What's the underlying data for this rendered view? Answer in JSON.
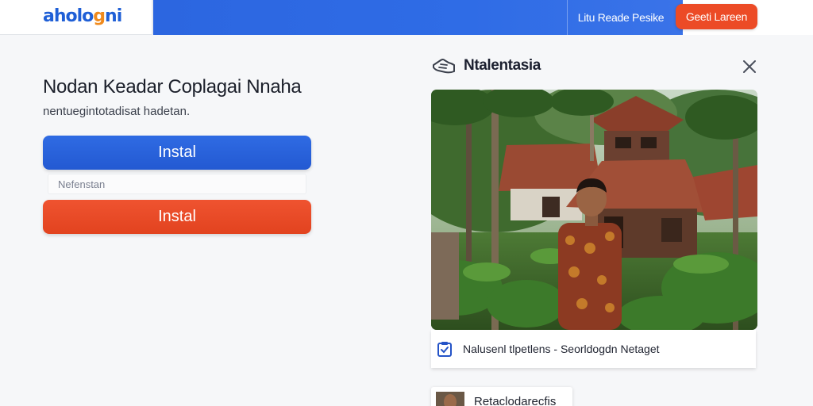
{
  "header": {
    "logo_part1": "aholo",
    "logo_part2": "g",
    "logo_part3": "ni",
    "nav_link": "Litu Reade Pesike",
    "cta_label": "Geeti Lareen"
  },
  "main": {
    "headline": "Nodan Keadar Coplagai Nnaha",
    "subline": "nentuegintotadisat hadetan.",
    "primary_button": "Instal",
    "input_placeholder": "Nefenstan",
    "secondary_button": "Instal"
  },
  "panel": {
    "title": "Ntalentasia",
    "caption": "Nalusenl tlpetlens - Seorldogdn Netaget",
    "thumb_label": "Retaclodarecfis"
  },
  "colors": {
    "accent_blue": "#2f6be3",
    "accent_red": "#ec4b26"
  }
}
